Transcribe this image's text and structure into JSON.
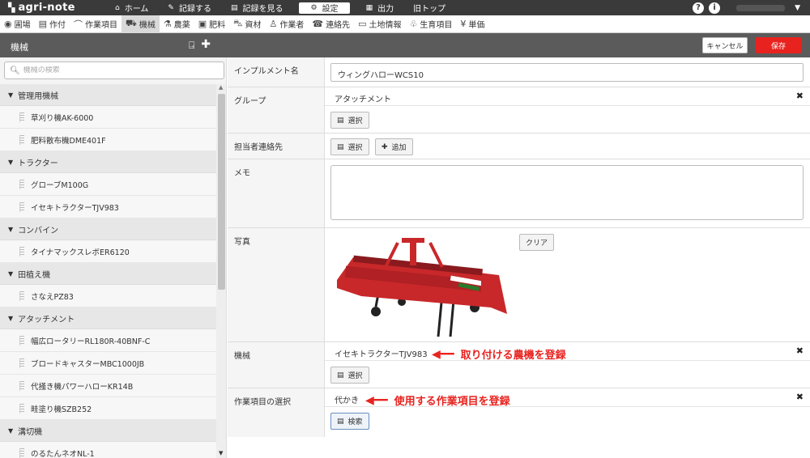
{
  "topbar": {
    "logo_text": "agri-note",
    "nav": [
      {
        "icon": "home-icon",
        "glyph": "⌂",
        "label": "ホーム"
      },
      {
        "icon": "pencil-icon",
        "glyph": "✎",
        "label": "記録する"
      },
      {
        "icon": "document-icon",
        "glyph": "▤",
        "label": "記録を見る"
      },
      {
        "icon": "gear-icon",
        "glyph": "⚙",
        "label": "設定",
        "active": true
      },
      {
        "icon": "file-icon",
        "glyph": "▦",
        "label": "出力"
      },
      {
        "icon": "",
        "glyph": "",
        "label": "旧トップ"
      }
    ]
  },
  "menubar": [
    {
      "icon": "location-pin-icon",
      "glyph": "◉",
      "label": "圃場"
    },
    {
      "icon": "notebook-icon",
      "glyph": "▤",
      "label": "作付"
    },
    {
      "icon": "sickle-icon",
      "glyph": "⌒",
      "label": "作業項目"
    },
    {
      "icon": "tractor-icon",
      "glyph": "⛟",
      "label": "機械",
      "active": true
    },
    {
      "icon": "flask-icon",
      "glyph": "⚗",
      "label": "農薬"
    },
    {
      "icon": "npk-icon",
      "glyph": "▣",
      "label": "肥料"
    },
    {
      "icon": "wheelbarrow-icon",
      "glyph": "⛍",
      "label": "資材"
    },
    {
      "icon": "person-icon",
      "glyph": "♙",
      "label": "作業者"
    },
    {
      "icon": "contact-book-icon",
      "glyph": "☎",
      "label": "連絡先"
    },
    {
      "icon": "land-icon",
      "glyph": "▭",
      "label": "土地情報"
    },
    {
      "icon": "plant-icon",
      "glyph": "♧",
      "label": "生育項目"
    },
    {
      "icon": "yen-icon",
      "glyph": "¥",
      "label": "単価"
    }
  ],
  "section": {
    "title": "機械",
    "cancel": "キャンセル",
    "save": "保存"
  },
  "search": {
    "placeholder": "機械の検索"
  },
  "tree": [
    {
      "group": "管理用機械",
      "items": [
        "草刈り機AK-6000",
        "肥料散布機DME401F"
      ]
    },
    {
      "group": "トラクター",
      "items": [
        "グローブM100G",
        "イセキトラクターTJV983"
      ]
    },
    {
      "group": "コンバイン",
      "items": [
        "タイナマックスレボER6120"
      ]
    },
    {
      "group": "田植え機",
      "items": [
        "さなえPZ83"
      ]
    },
    {
      "group": "アタッチメント",
      "items": [
        "幅広ロータリーRL180R-40BNF-C",
        "ブロードキャスターMBC1000JB",
        "代掻き機パワーハローKR14B",
        "畦塗り機SZB252"
      ]
    },
    {
      "group": "溝切機",
      "items": [
        "のるたんネオNL-1"
      ]
    }
  ],
  "form": {
    "implement_label": "インプルメント名",
    "implement_value": "ウィングハローWCS10",
    "group_label": "グループ",
    "group_value": "アタッチメント",
    "select": "選択",
    "contact_label": "担当者連絡先",
    "add": "追加",
    "memo_label": "メモ",
    "photo_label": "写真",
    "clear": "クリア",
    "machine_label": "機械",
    "machine_value": "イセキトラクターTJV983",
    "work_label": "作業項目の選択",
    "work_value": "代かき",
    "search_btn": "検索"
  },
  "annotations": {
    "machine": "取り付ける農機を登録",
    "work": "使用する作業項目を登録"
  },
  "colors": {
    "accent": "#e8231f",
    "implement_red": "#c8282a"
  }
}
